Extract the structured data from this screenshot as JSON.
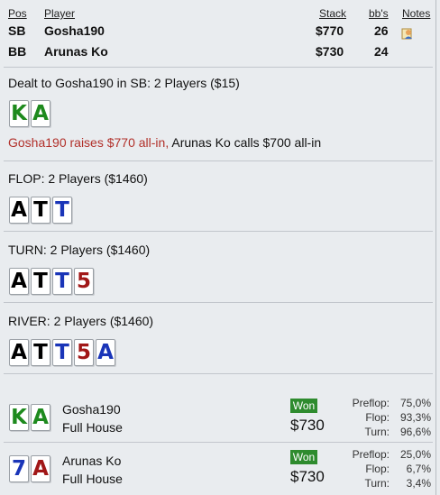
{
  "header": {
    "col_pos": "Pos",
    "col_player": "Player",
    "col_stack": "Stack",
    "col_bbs": "bb's",
    "col_notes": "Notes",
    "players": [
      {
        "pos": "SB",
        "name": "Gosha190",
        "stack": "$770",
        "bbs": "26",
        "notes_icon": "notes-icon"
      },
      {
        "pos": "BB",
        "name": "Arunas Ko",
        "stack": "$730",
        "bbs": "24"
      }
    ]
  },
  "preflop": {
    "title": "Dealt to Gosha190 in SB: 2 Players ($15)",
    "cards": [
      {
        "rank": "K",
        "suit": "clubs"
      },
      {
        "rank": "A",
        "suit": "clubs"
      }
    ],
    "action_hero": "Gosha190 raises $770 all-in,",
    "action_villain": " Arunas Ko calls $700 all-in"
  },
  "flop": {
    "title": "FLOP: 2 Players ($1460)",
    "cards": [
      {
        "rank": "A",
        "suit": "spades"
      },
      {
        "rank": "T",
        "suit": "spades"
      },
      {
        "rank": "T",
        "suit": "diamonds"
      }
    ]
  },
  "turn": {
    "title": "TURN: 2 Players ($1460)",
    "cards": [
      {
        "rank": "A",
        "suit": "spades"
      },
      {
        "rank": "T",
        "suit": "spades"
      },
      {
        "rank": "T",
        "suit": "diamonds"
      },
      {
        "rank": "5",
        "suit": "hearts"
      }
    ]
  },
  "river": {
    "title": "RIVER: 2 Players ($1460)",
    "cards": [
      {
        "rank": "A",
        "suit": "spades"
      },
      {
        "rank": "T",
        "suit": "spades"
      },
      {
        "rank": "T",
        "suit": "diamonds"
      },
      {
        "rank": "5",
        "suit": "hearts"
      },
      {
        "rank": "A",
        "suit": "diamonds"
      }
    ]
  },
  "results": [
    {
      "name": "Gosha190",
      "hand": "Full House",
      "badge": "Won",
      "amount": "$730",
      "cards": [
        {
          "rank": "K",
          "suit": "clubs"
        },
        {
          "rank": "A",
          "suit": "clubs"
        }
      ],
      "stats": [
        {
          "label": "Preflop:",
          "value": "75,0%"
        },
        {
          "label": "Flop:",
          "value": "93,3%"
        },
        {
          "label": "Turn:",
          "value": "96,6%"
        }
      ]
    },
    {
      "name": "Arunas Ko",
      "hand": "Full House",
      "badge": "Won",
      "amount": "$730",
      "cards": [
        {
          "rank": "7",
          "suit": "diamonds"
        },
        {
          "rank": "A",
          "suit": "hearts"
        }
      ],
      "stats": [
        {
          "label": "Preflop:",
          "value": "25,0%"
        },
        {
          "label": "Flop:",
          "value": "6,7%"
        },
        {
          "label": "Turn:",
          "value": "3,4%"
        }
      ]
    }
  ],
  "colors": {
    "background": "#e9ecef",
    "clubs": "#1e8a1e",
    "spades": "#000000",
    "diamonds": "#1a35b8",
    "hearts": "#a11717",
    "won_badge": "#2e8b2e",
    "hero_action": "#b1302a"
  }
}
